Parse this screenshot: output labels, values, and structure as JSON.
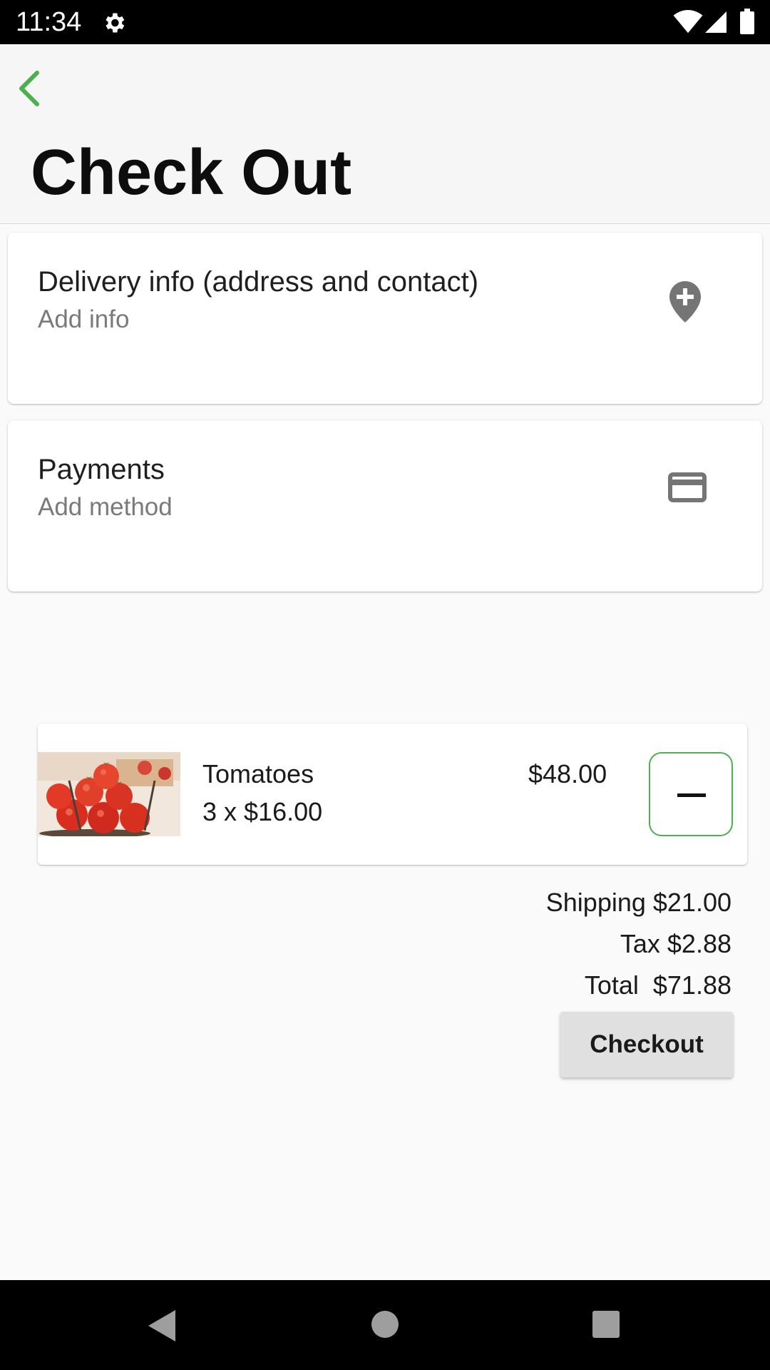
{
  "status_bar": {
    "time": "11:34",
    "icons": [
      "gear-icon",
      "wifi-icon",
      "signal-icon",
      "battery-icon"
    ]
  },
  "app_bar": {
    "title": "Check Out",
    "back_icon": "chevron-left-icon"
  },
  "delivery_card": {
    "title": "Delivery info (address and contact)",
    "subtitle": "Add info",
    "icon": "add-location-icon"
  },
  "payment_card": {
    "title": "Payments",
    "subtitle": "Add method",
    "icon": "credit-card-icon"
  },
  "cart_items": [
    {
      "name": "Tomatoes",
      "quantity_line": "3 x $16.00",
      "line_total": "$48.00",
      "image_icon": "tomatoes-photo",
      "remove_icon": "minus-icon"
    }
  ],
  "summary": {
    "shipping": "Shipping $21.00",
    "tax": "Tax $2.88",
    "total": "Total  $71.88"
  },
  "checkout_label": "Checkout",
  "nav_bar": {
    "icons": [
      "nav-back-icon",
      "nav-home-icon",
      "nav-recents-icon"
    ]
  },
  "colors": {
    "accent": "#4caf50",
    "background": "#fafafa",
    "icon_gray": "#757575",
    "checkout_button": "#e0e0e0"
  }
}
